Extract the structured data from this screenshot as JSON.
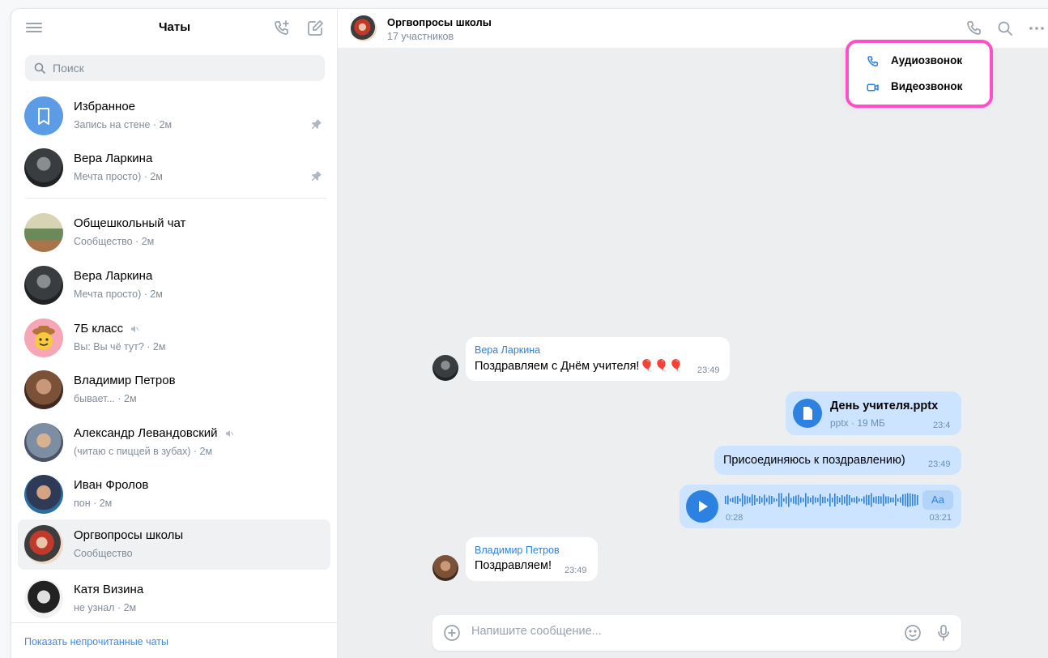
{
  "sidebar": {
    "title": "Чаты",
    "search_placeholder": "Поиск",
    "pinned": [
      {
        "name": "Избранное",
        "sub": "Запись на стене · 2м"
      },
      {
        "name": "Вера Ларкина",
        "sub": "Мечта просто) · 2м"
      }
    ],
    "chats": [
      {
        "name": "Общешкольный чат",
        "sub": "Сообщество · 2м"
      },
      {
        "name": "Вера Ларкина",
        "sub": "Мечта просто) · 2м"
      },
      {
        "name": "7Б класс",
        "sub": "Вы: Вы чё тут? · 2м"
      },
      {
        "name": "Владимир Петров",
        "sub": "бывает... · 2м"
      },
      {
        "name": "Александр Левандовский",
        "sub": "(читаю с пиццей в зубах) · 2м"
      },
      {
        "name": "Иван Фролов",
        "sub": "пон · 2м"
      },
      {
        "name": "Оргвопросы школы",
        "sub": "Сообщество"
      },
      {
        "name": "Катя Визина",
        "sub": "не узнал · 2м"
      }
    ],
    "footer_link": "Показать непрочитанные чаты"
  },
  "header": {
    "title": "Оргвопросы школы",
    "subtitle": "17 участников"
  },
  "call_menu": {
    "audio": "Аудиозвонок",
    "video": "Видеозвонок"
  },
  "messages": {
    "m1": {
      "author": "Вера Ларкина",
      "text": "Поздравляем с Днём учителя!🎈🎈🎈",
      "time": "23:49"
    },
    "file": {
      "name": "День учителя.pptx",
      "meta": "pptx · 19 МБ",
      "time": "23:4"
    },
    "m2": {
      "text": "Присоединяюсь к поздравлению)",
      "time": "23:49"
    },
    "voice": {
      "elapsed": "0:28",
      "duration": "03:21",
      "aa": "Aa"
    },
    "m3": {
      "author": "Владимир Петров",
      "text": "Поздравляем!",
      "time": "23:49"
    }
  },
  "composer": {
    "placeholder": "Напишите сообщение..."
  },
  "colors": {
    "accent": "#2d81e0",
    "highlight": "#ff4fc8",
    "outgoing_bubble": "#cce4ff"
  }
}
